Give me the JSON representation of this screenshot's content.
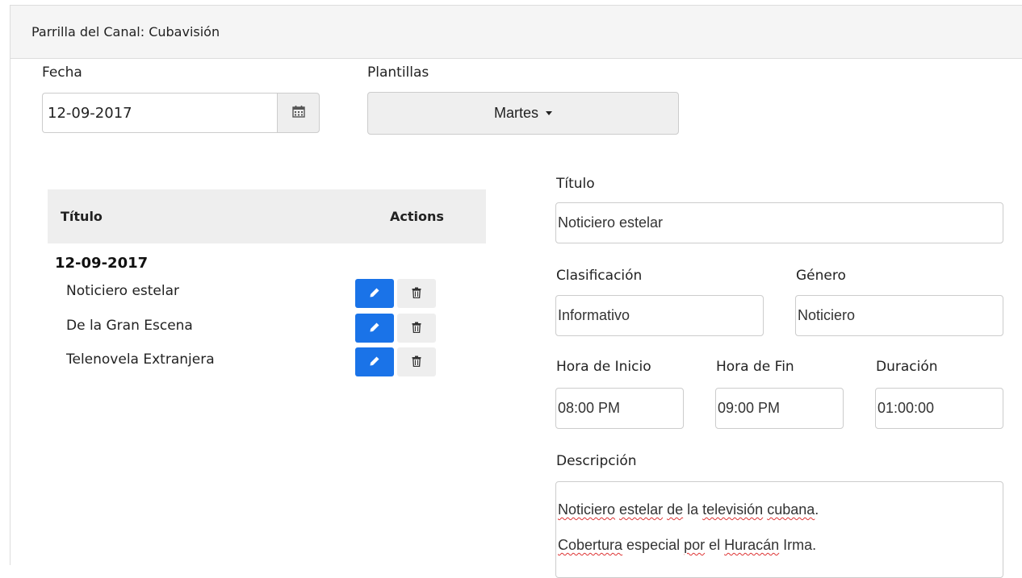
{
  "panel": {
    "title": "Parrilla del Canal: Cubavisión"
  },
  "fecha": {
    "label": "Fecha",
    "value": "12-09-2017",
    "icon": "calendar-icon"
  },
  "plantillas": {
    "label": "Plantillas",
    "selected": "Martes"
  },
  "table": {
    "headers": {
      "title": "Título",
      "actions": "Actions"
    },
    "group_date": "12-09-2017",
    "rows": [
      {
        "title": "Noticiero estelar"
      },
      {
        "title": "De la Gran Escena"
      },
      {
        "title": "Telenovela Extranjera"
      }
    ],
    "edit_icon": "pencil-icon",
    "delete_icon": "trash-icon",
    "edit_color": "#1a73e8"
  },
  "form": {
    "titulo": {
      "label": "Título",
      "value": "Noticiero estelar"
    },
    "clasificacion": {
      "label": "Clasificación",
      "value": "Informativo"
    },
    "genero": {
      "label": "Género",
      "value": "Noticiero"
    },
    "hora_inicio": {
      "label": "Hora de Inicio",
      "value": "08:00 PM"
    },
    "hora_fin": {
      "label": "Hora de Fin",
      "value": "09:00 PM"
    },
    "duracion": {
      "label": "Duración",
      "value": "01:00:00"
    },
    "descripcion": {
      "label": "Descripción",
      "line1": {
        "w1": "Noticiero",
        "t1": " ",
        "w2": "estelar",
        "t2": " ",
        "w3": "de",
        "t3": " la ",
        "w4": "televisión",
        "t4": " ",
        "w5": "cubana",
        "t5": "."
      },
      "line2": {
        "w1": "Cobertura",
        "t1": " especial ",
        "w2": "por",
        "t2": " el ",
        "w3": "Huracán",
        "t3": " Irma."
      }
    }
  }
}
